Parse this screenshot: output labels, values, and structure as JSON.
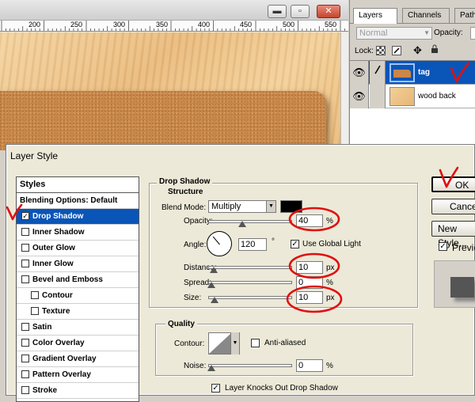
{
  "document": {
    "window_buttons": {
      "minimize": "▬",
      "maximize": "▫",
      "close": "✕"
    },
    "ruler_labels": [
      "200",
      "250",
      "300",
      "350",
      "400",
      "450",
      "500",
      "550"
    ]
  },
  "layers_panel": {
    "tabs": [
      "Layers",
      "Channels",
      "Paths"
    ],
    "blend_mode": "Normal",
    "opacity_label": "Opacity:",
    "lock_label": "Lock:",
    "layers": [
      {
        "name": "tag",
        "selected": true
      },
      {
        "name": "wood back",
        "selected": false
      }
    ]
  },
  "dialog": {
    "title": "Layer Style",
    "styles_header": "Styles",
    "style_items": [
      {
        "label": "Blending Options: Default",
        "checkbox": false,
        "checked": false,
        "indent": false,
        "selected": false
      },
      {
        "label": "Drop Shadow",
        "checkbox": true,
        "checked": true,
        "indent": false,
        "selected": true
      },
      {
        "label": "Inner Shadow",
        "checkbox": true,
        "checked": false,
        "indent": false,
        "selected": false
      },
      {
        "label": "Outer Glow",
        "checkbox": true,
        "checked": false,
        "indent": false,
        "selected": false
      },
      {
        "label": "Inner Glow",
        "checkbox": true,
        "checked": false,
        "indent": false,
        "selected": false
      },
      {
        "label": "Bevel and Emboss",
        "checkbox": true,
        "checked": false,
        "indent": false,
        "selected": false
      },
      {
        "label": "Contour",
        "checkbox": true,
        "checked": false,
        "indent": true,
        "selected": false
      },
      {
        "label": "Texture",
        "checkbox": true,
        "checked": false,
        "indent": true,
        "selected": false
      },
      {
        "label": "Satin",
        "checkbox": true,
        "checked": false,
        "indent": false,
        "selected": false
      },
      {
        "label": "Color Overlay",
        "checkbox": true,
        "checked": false,
        "indent": false,
        "selected": false
      },
      {
        "label": "Gradient Overlay",
        "checkbox": true,
        "checked": false,
        "indent": false,
        "selected": false
      },
      {
        "label": "Pattern Overlay",
        "checkbox": true,
        "checked": false,
        "indent": false,
        "selected": false
      },
      {
        "label": "Stroke",
        "checkbox": true,
        "checked": false,
        "indent": false,
        "selected": false
      }
    ],
    "drop_shadow": {
      "group_title": "Drop Shadow",
      "structure_title": "Structure",
      "blend_mode_label": "Blend Mode:",
      "blend_mode_value": "Multiply",
      "shadow_color": "#000000",
      "opacity_label": "Opacity:",
      "opacity_value": "40",
      "opacity_fraction": 0.4,
      "percent_unit": "%",
      "angle_label": "Angle:",
      "angle_value": "120",
      "degree_unit": "°",
      "use_global_light_label": "Use Global Light",
      "use_global_light": true,
      "distance_label": "Distance:",
      "distance_value": "10",
      "distance_fraction": 0.03,
      "px_unit": "px",
      "spread_label": "Spread:",
      "spread_value": "0",
      "spread_fraction": 0.0,
      "size_label": "Size:",
      "size_value": "10",
      "size_fraction": 0.04
    },
    "quality": {
      "title": "Quality",
      "contour_label": "Contour:",
      "anti_aliased_label": "Anti-aliased",
      "anti_aliased": false,
      "noise_label": "Noise:",
      "noise_value": "0",
      "noise_fraction": 0.0,
      "knockout_label": "Layer Knocks Out Drop Shadow",
      "knockout": true
    },
    "buttons": {
      "ok": "OK",
      "cancel": "Cancel",
      "new_style": "New Style...",
      "preview_label": "Preview",
      "preview_checked": true
    }
  },
  "colors": {
    "selection_blue": "#0a55b8",
    "annotation_red": "#e01010",
    "cork": "#c9874a",
    "wood": "#e8b87a"
  }
}
